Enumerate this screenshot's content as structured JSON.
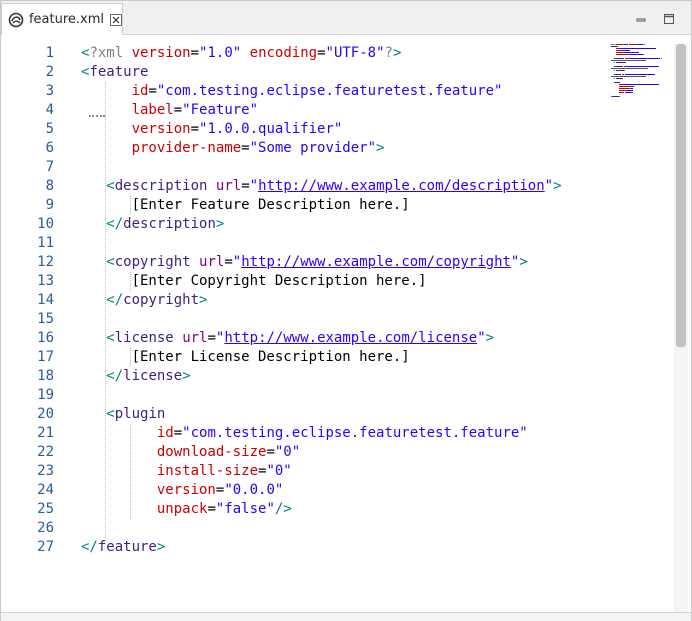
{
  "tab": {
    "title": "feature.xml",
    "file_icon": "feature-file-icon",
    "close_glyph": "⊠"
  },
  "window_controls": {
    "minimize_icon": "minimize-icon",
    "maximize_icon": "maximize-icon"
  },
  "editor": {
    "line_numbers": [
      "1",
      "2",
      "3",
      "4",
      "5",
      "6",
      "7",
      "8",
      "9",
      "10",
      "11",
      "12",
      "13",
      "14",
      "15",
      "16",
      "17",
      "18",
      "19",
      "20",
      "21",
      "22",
      "23",
      "24",
      "25",
      "26",
      "27"
    ],
    "lines": [
      [
        {
          "t": "<",
          "c": "ang"
        },
        {
          "t": "?xml ",
          "c": "pi"
        },
        {
          "t": "version",
          "c": "attr2"
        },
        {
          "t": "=",
          "c": "text"
        },
        {
          "t": "\"1.0\"",
          "c": "val"
        },
        {
          "t": " ",
          "c": "text"
        },
        {
          "t": "encoding",
          "c": "attr2"
        },
        {
          "t": "=",
          "c": "text"
        },
        {
          "t": "\"UTF-8\"",
          "c": "val"
        },
        {
          "t": "?",
          "c": "pi"
        },
        {
          "t": ">",
          "c": "ang"
        }
      ],
      [
        {
          "t": "<",
          "c": "ang"
        },
        {
          "t": "feature",
          "c": "tag"
        }
      ],
      [
        {
          "t": "      ",
          "c": "text"
        },
        {
          "t": "id",
          "c": "attr2"
        },
        {
          "t": "=",
          "c": "text"
        },
        {
          "t": "\"com.testing.eclipse.featuretest.feature\"",
          "c": "val"
        }
      ],
      [
        {
          "t": "      ",
          "c": "text"
        },
        {
          "t": "label",
          "c": "attr2"
        },
        {
          "t": "=",
          "c": "text"
        },
        {
          "t": "\"Feature\"",
          "c": "val"
        }
      ],
      [
        {
          "t": "      ",
          "c": "text"
        },
        {
          "t": "version",
          "c": "attr2"
        },
        {
          "t": "=",
          "c": "text"
        },
        {
          "t": "\"1.0.0.qualifier\"",
          "c": "val"
        }
      ],
      [
        {
          "t": "      ",
          "c": "text"
        },
        {
          "t": "provider-name",
          "c": "attr2"
        },
        {
          "t": "=",
          "c": "text"
        },
        {
          "t": "\"Some provider\"",
          "c": "val"
        },
        {
          "t": ">",
          "c": "ang"
        }
      ],
      [],
      [
        {
          "t": "   ",
          "c": "text"
        },
        {
          "t": "<",
          "c": "ang"
        },
        {
          "t": "description",
          "c": "tag"
        },
        {
          "t": " ",
          "c": "text"
        },
        {
          "t": "url",
          "c": "attr"
        },
        {
          "t": "=",
          "c": "text"
        },
        {
          "t": "\"",
          "c": "val"
        },
        {
          "t": "http://www.example.com/description",
          "c": "url"
        },
        {
          "t": "\"",
          "c": "val"
        },
        {
          "t": ">",
          "c": "ang"
        }
      ],
      [
        {
          "t": "      [Enter Feature Description here.]",
          "c": "text"
        }
      ],
      [
        {
          "t": "   ",
          "c": "text"
        },
        {
          "t": "</",
          "c": "ang"
        },
        {
          "t": "description",
          "c": "tag"
        },
        {
          "t": ">",
          "c": "ang"
        }
      ],
      [],
      [
        {
          "t": "   ",
          "c": "text"
        },
        {
          "t": "<",
          "c": "ang"
        },
        {
          "t": "copyright",
          "c": "tag"
        },
        {
          "t": " ",
          "c": "text"
        },
        {
          "t": "url",
          "c": "attr"
        },
        {
          "t": "=",
          "c": "text"
        },
        {
          "t": "\"",
          "c": "val"
        },
        {
          "t": "http://www.example.com/copyright",
          "c": "url"
        },
        {
          "t": "\"",
          "c": "val"
        },
        {
          "t": ">",
          "c": "ang"
        }
      ],
      [
        {
          "t": "      [Enter Copyright Description here.]",
          "c": "text"
        }
      ],
      [
        {
          "t": "   ",
          "c": "text"
        },
        {
          "t": "</",
          "c": "ang"
        },
        {
          "t": "copyright",
          "c": "tag"
        },
        {
          "t": ">",
          "c": "ang"
        }
      ],
      [],
      [
        {
          "t": "   ",
          "c": "text"
        },
        {
          "t": "<",
          "c": "ang"
        },
        {
          "t": "license",
          "c": "tag"
        },
        {
          "t": " ",
          "c": "text"
        },
        {
          "t": "url",
          "c": "attr"
        },
        {
          "t": "=",
          "c": "text"
        },
        {
          "t": "\"",
          "c": "val"
        },
        {
          "t": "http://www.example.com/license",
          "c": "url"
        },
        {
          "t": "\"",
          "c": "val"
        },
        {
          "t": ">",
          "c": "ang"
        }
      ],
      [
        {
          "t": "      [Enter License Description here.]",
          "c": "text"
        }
      ],
      [
        {
          "t": "   ",
          "c": "text"
        },
        {
          "t": "</",
          "c": "ang"
        },
        {
          "t": "license",
          "c": "tag"
        },
        {
          "t": ">",
          "c": "ang"
        }
      ],
      [],
      [
        {
          "t": "   ",
          "c": "text"
        },
        {
          "t": "<",
          "c": "ang"
        },
        {
          "t": "plugin",
          "c": "tag"
        }
      ],
      [
        {
          "t": "         ",
          "c": "text"
        },
        {
          "t": "id",
          "c": "attr2"
        },
        {
          "t": "=",
          "c": "text"
        },
        {
          "t": "\"com.testing.eclipse.featuretest.feature\"",
          "c": "val"
        }
      ],
      [
        {
          "t": "         ",
          "c": "text"
        },
        {
          "t": "download-size",
          "c": "attr2"
        },
        {
          "t": "=",
          "c": "text"
        },
        {
          "t": "\"0\"",
          "c": "val"
        }
      ],
      [
        {
          "t": "         ",
          "c": "text"
        },
        {
          "t": "install-size",
          "c": "attr2"
        },
        {
          "t": "=",
          "c": "text"
        },
        {
          "t": "\"0\"",
          "c": "val"
        }
      ],
      [
        {
          "t": "         ",
          "c": "text"
        },
        {
          "t": "version",
          "c": "attr2"
        },
        {
          "t": "=",
          "c": "text"
        },
        {
          "t": "\"0.0.0\"",
          "c": "val"
        }
      ],
      [
        {
          "t": "         ",
          "c": "text"
        },
        {
          "t": "unpack",
          "c": "attr2"
        },
        {
          "t": "=",
          "c": "text"
        },
        {
          "t": "\"false\"",
          "c": "val"
        },
        {
          "t": "/>",
          "c": "ang"
        }
      ],
      [],
      [
        {
          "t": "</",
          "c": "ang"
        },
        {
          "t": "feature",
          "c": "tag"
        },
        {
          "t": ">",
          "c": "ang"
        }
      ]
    ]
  },
  "colors": {
    "angle": "#008080",
    "tag": "#3f1f7f",
    "attribute": "#cc0000",
    "value": "#2a00ff",
    "line_number": "#2b5c94"
  }
}
